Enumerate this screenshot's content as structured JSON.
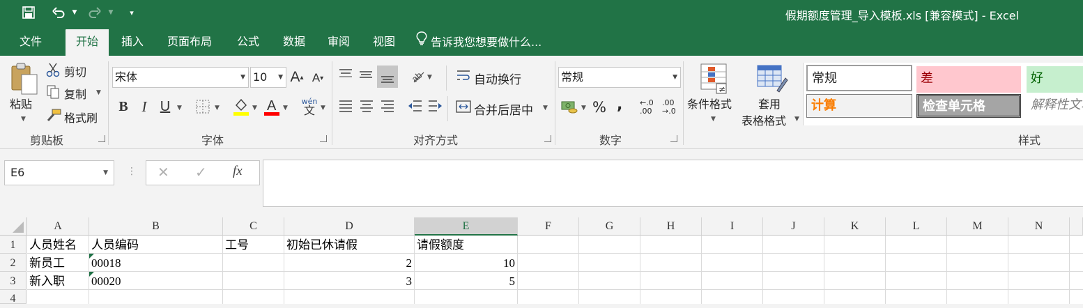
{
  "title": "假期额度管理_导入模板.xls  [兼容模式] - Excel",
  "tabs": [
    "文件",
    "开始",
    "插入",
    "页面布局",
    "公式",
    "数据",
    "审阅",
    "视图"
  ],
  "active_tab": "开始",
  "tell_me": "告诉我您想要做什么...",
  "clipboard": {
    "paste": "粘贴",
    "cut": "剪切",
    "copy": "复制",
    "format_painter": "格式刷",
    "label": "剪贴板"
  },
  "font": {
    "name": "宋体",
    "size": "10",
    "label": "字体",
    "pinyin": "wén",
    "pinyin_char": "文"
  },
  "alignment": {
    "wrap": "自动换行",
    "merge": "合并后居中",
    "label": "对齐方式"
  },
  "number": {
    "format": "常规",
    "label": "数字",
    "percent": "%",
    "comma": ",",
    "inc_decimal": "←.0 .00",
    "dec_decimal": ".00 →.0"
  },
  "conditional": {
    "label": "条件格式"
  },
  "table_format": {
    "line1": "套用",
    "line2": "表格格式"
  },
  "styles": {
    "label": "样式",
    "items": [
      {
        "name": "常规",
        "bg": "#ffffff",
        "fg": "#222222",
        "border": "#9e9e9e"
      },
      {
        "name": "差",
        "bg": "#ffc7ce",
        "fg": "#9c0006",
        "border": "#ffc7ce"
      },
      {
        "name": "好",
        "bg": "#c6efce",
        "fg": "#006100",
        "border": "#c6efce"
      },
      {
        "name": "计算",
        "bg": "#f2f2f2",
        "fg": "#fa7d00",
        "border": "#7f7f7f"
      },
      {
        "name": "检查单元格",
        "bg": "#a5a5a5",
        "fg": "#ffffff",
        "border": "#3f3f3f"
      },
      {
        "name": "解释性文本",
        "bg": "#f3f3f3",
        "fg": "#7f7f7f",
        "border": "#f3f3f3"
      }
    ]
  },
  "name_box": "E6",
  "formula_buttons": {
    "cancel": "✕",
    "enter": "✓",
    "fx": "fx"
  },
  "formula_content": "",
  "columns": [
    "A",
    "B",
    "C",
    "D",
    "E",
    "F",
    "G",
    "H",
    "I",
    "J",
    "K",
    "L",
    "M",
    "N"
  ],
  "selected_column": "E",
  "rows": [
    "1",
    "2",
    "3",
    "4"
  ],
  "cells": {
    "r1": [
      "人员姓名",
      "人员编码",
      "工号",
      "初始已休请假",
      "请假额度"
    ],
    "r2": [
      "新员工",
      "00018",
      "",
      "2",
      "10"
    ],
    "r3": [
      "新入职",
      "00020",
      "",
      "3",
      "5"
    ]
  },
  "colors": {
    "brand": "#217346",
    "triangle": "#1e7145"
  }
}
